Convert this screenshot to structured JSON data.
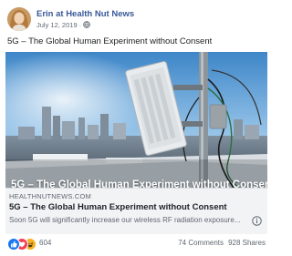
{
  "post": {
    "author": "Erin at Health Nut News",
    "date": "July 12, 2019",
    "caption": "5G – The Global Human Experiment without Consent"
  },
  "link": {
    "image_title": "5G – The Global Human Experiment without Consent",
    "domain": "HEALTHNUTNEWS.COM",
    "title": "5G – The Global Human Experiment without Consent",
    "description": "Soon 5G will significantly increase our wireless RF radiation exposure..."
  },
  "footer": {
    "reaction_count": "604",
    "comments": "74 Comments",
    "shares": "928 Shares"
  },
  "icons": {
    "audience": "globe-icon",
    "info": "info-icon",
    "reactions": [
      "like-reaction-icon",
      "love-reaction-icon",
      "haha-reaction-icon"
    ]
  },
  "colors": {
    "author": "#385898",
    "like": "#1877f2",
    "love": "#f33e58",
    "haha": "#f7b125",
    "preview_bg": "#f2f3f5"
  }
}
